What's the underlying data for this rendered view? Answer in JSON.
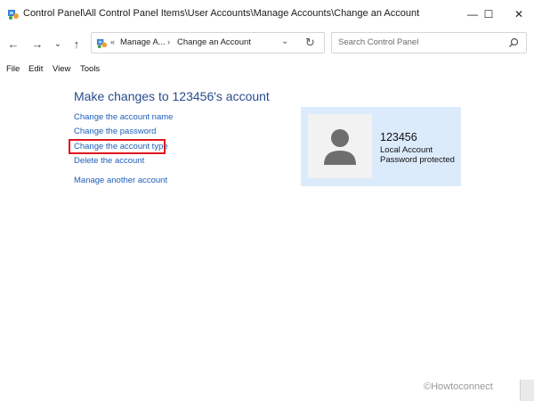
{
  "window": {
    "title": "Control Panel\\All Control Panel Items\\User Accounts\\Manage Accounts\\Change an Account",
    "minimize_glyph": "—",
    "maximize_glyph": "☐",
    "close_glyph": "✕"
  },
  "nav": {
    "back_glyph": "←",
    "forward_glyph": "→",
    "recent_glyph": "⌄",
    "up_glyph": "↑"
  },
  "address": {
    "chevrons": "«",
    "segment1": "Manage A...",
    "separator": "›",
    "segment2": "Change an Account",
    "dropdown_glyph": "⌄",
    "refresh_glyph": "↻"
  },
  "search": {
    "placeholder": "Search Control Panel"
  },
  "menu": {
    "file": "File",
    "edit": "Edit",
    "view": "View",
    "tools": "Tools"
  },
  "main": {
    "heading": "Make changes to 123456's account",
    "links": {
      "change_name": "Change the account name",
      "change_password": "Change the password",
      "change_type": "Change the account type",
      "delete": "Delete the account",
      "manage_another": "Manage another account"
    }
  },
  "account": {
    "name": "123456",
    "type": "Local Account",
    "status": "Password protected"
  },
  "watermark": "©Howtoconnect",
  "colors": {
    "link": "#1d5fb8",
    "heading": "#2b4a8c",
    "highlight": "#e0161e",
    "card_bg": "#dcebfc"
  }
}
